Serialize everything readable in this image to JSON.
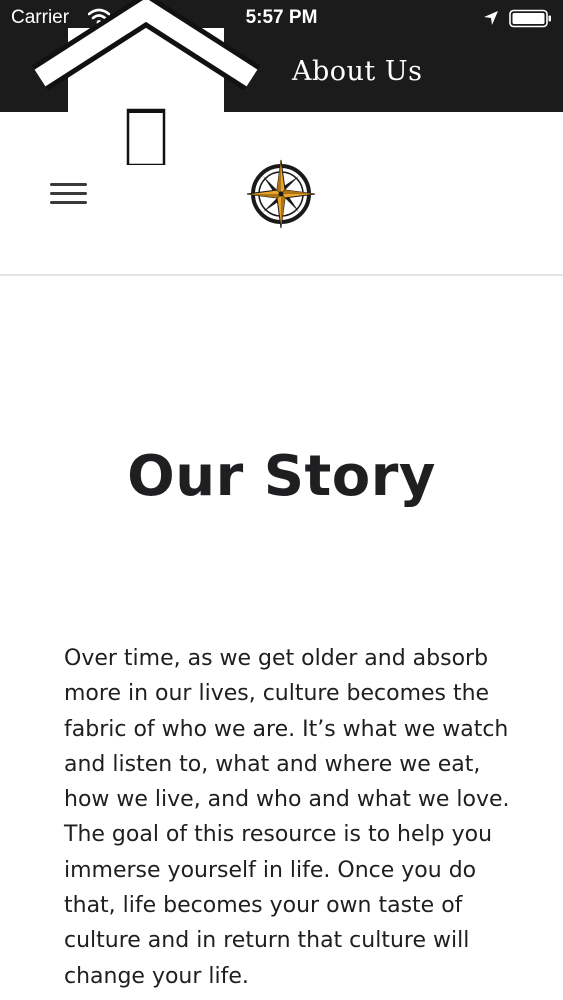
{
  "status_bar": {
    "carrier": "Carrier",
    "time": "5:57 PM",
    "icons": [
      "wifi-icon",
      "location-arrow-icon",
      "battery-icon"
    ]
  },
  "nav_bar": {
    "title": "About Us",
    "logo_icon": "house-icon",
    "background_color": "#1c1b1c",
    "text_color": "#ffffff"
  },
  "site_header": {
    "menu_icon": "hamburger-menu-icon",
    "logo_icon": "compass-rose-icon",
    "accent_color": "#e8a52a"
  },
  "main": {
    "heading": "Our Story",
    "body": "Over time, as we get older and absorb more in our lives, culture becomes the fabric of who we are. It’s what we watch and listen to, what and where we eat, how we live, and who and what we love. The goal of this resource is to help you immerse yourself in life. Once you do that, life becomes your own taste of culture and in return that culture will change your life.",
    "text_color": "#1f1e20"
  }
}
